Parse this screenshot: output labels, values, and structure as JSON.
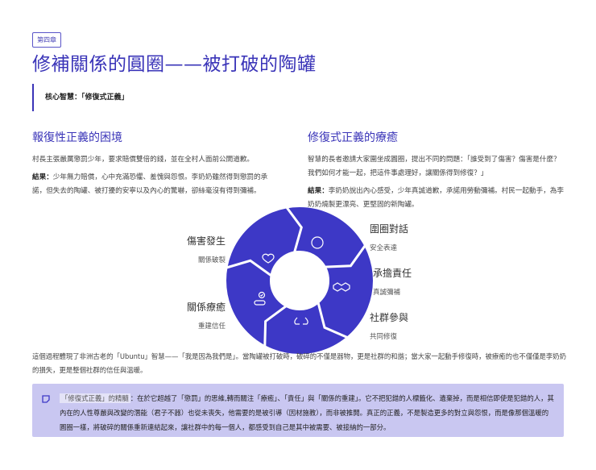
{
  "chapter": "第四章",
  "title": "修補關係的圓圈——被打破的陶罐",
  "core_wisdom": "核心智慧：「修復式正義」",
  "left": {
    "heading": "報復性正義的困境",
    "p1": "村長主張嚴厲懲罰少年，要求賠償雙倍的錢，並在全村人面前公開道歉。",
    "result_label": "結果：",
    "result": "少年無力賠償，心中充滿恐懼、羞愧與怨恨。李奶奶雖然得到懲罰的承諾，但失去的陶罐、被打擾的安寧以及內心的驚嚇，卻絲毫沒有得到彌補。"
  },
  "right": {
    "heading": "修復式正義的療癒",
    "p1": "智慧的長者邀請大家圍坐成圓圈，提出不同的問題：「誰受到了傷害？傷害是什麼？我們如何才能一起，把這件事處理好，讓關係得到修復？」",
    "result_label": "結果：",
    "result": "李奶奶說出內心感受，少年真誠道歉，承諾用勞動彌補。村民一起動手，為李奶奶燒製更漂亮、更堅固的新陶罐。"
  },
  "cycle": [
    {
      "title": "傷害發生",
      "sub": "關係破裂",
      "icon": "heart-icon"
    },
    {
      "title": "圍圈對話",
      "sub": "安全表達",
      "icon": "circle-icon"
    },
    {
      "title": "承擔責任",
      "sub": "真誠彌補",
      "icon": "handshake-icon"
    },
    {
      "title": "社群參與",
      "sub": "共同修復",
      "icon": "hands-icon"
    },
    {
      "title": "關係療癒",
      "sub": "重建信任",
      "icon": "pill-check-icon"
    }
  ],
  "colors": {
    "primary": "#3d38c6",
    "callout_bg": "#c9c7f1"
  },
  "paragraph": "這個過程體現了非洲古老的「Ubuntu」智慧——「我是因為我們是」。當陶罐被打破時，破碎的不僅是器物，更是社群的和諧；當大家一起動手修復時，被療癒的也不僅僅是李奶奶的損失，更是整個社群的信任與溫暖。",
  "callout": {
    "highlight": "「修復式正義」的精髓",
    "text": "：在於它超越了「懲罰」的思維,轉而關注「療癒」、「責任」與「關係的重建」。它不把犯錯的人標籤化、遺棄掉，而是相信即使是犯錯的人，其內在的人性尊嚴與改變的潛能（君子不器）也從未喪失，他需要的是被引導（因材施教），而非被推開。真正的正義，不是製造更多的對立與怨恨，而是像那個溫暖的圓圈一樣，將破碎的關係重新連結起來，讓社群中的每一個人，都感受到自己是其中被需要、被接納的一部分。"
  }
}
